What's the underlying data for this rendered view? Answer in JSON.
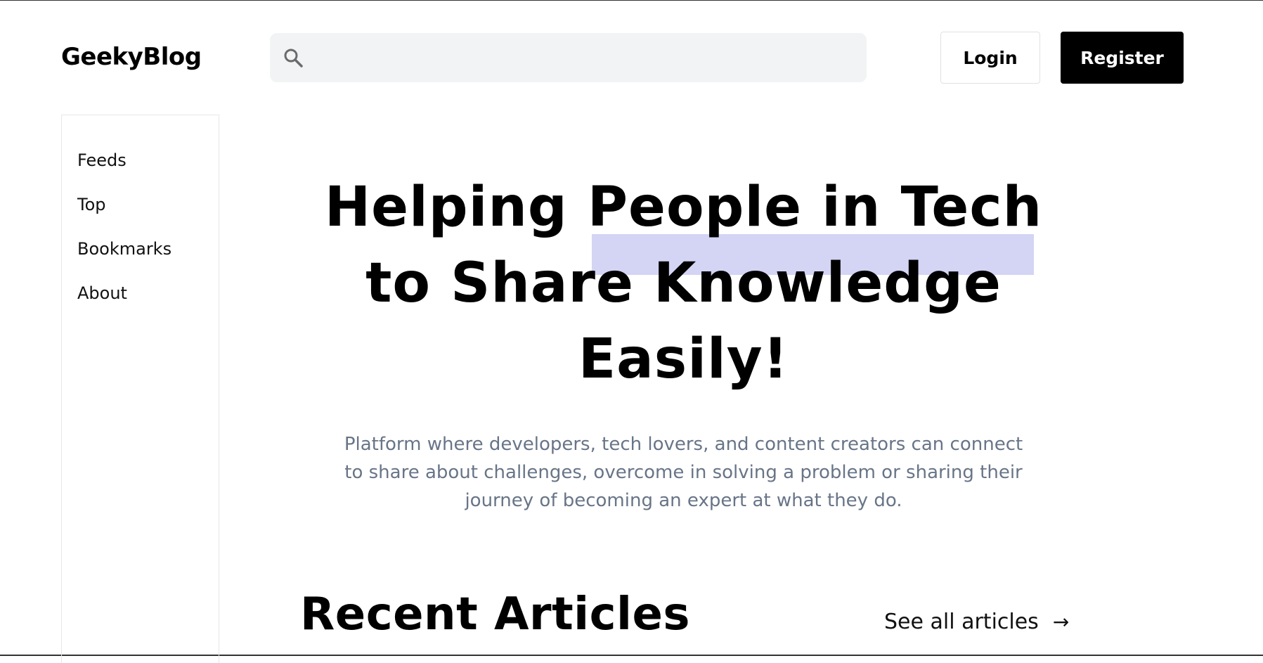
{
  "header": {
    "logo": "GeekyBlog",
    "search": {
      "placeholder": "",
      "value": ""
    },
    "login_label": "Login",
    "register_label": "Register"
  },
  "sidebar": {
    "items": [
      {
        "label": "Feeds"
      },
      {
        "label": "Top"
      },
      {
        "label": "Bookmarks"
      },
      {
        "label": "About"
      }
    ]
  },
  "hero": {
    "title_line1": "Helping People in Tech",
    "title_line2": "to Share Knowledge",
    "title_line3": "Easily!",
    "subtitle_line1": "Platform where developers, tech lovers, and content creators can connect",
    "subtitle_line2": "to share about challenges, overcome in solving a problem or sharing their",
    "subtitle_line3": "journey of becoming an expert at what they do.",
    "highlight_color": "#d4d4f5"
  },
  "recent": {
    "heading": "Recent Articles",
    "see_all_label": "See all articles",
    "see_all_icon": "arrow-right-icon",
    "see_all_glyph": "→"
  },
  "icons": {
    "search": "search-icon"
  }
}
